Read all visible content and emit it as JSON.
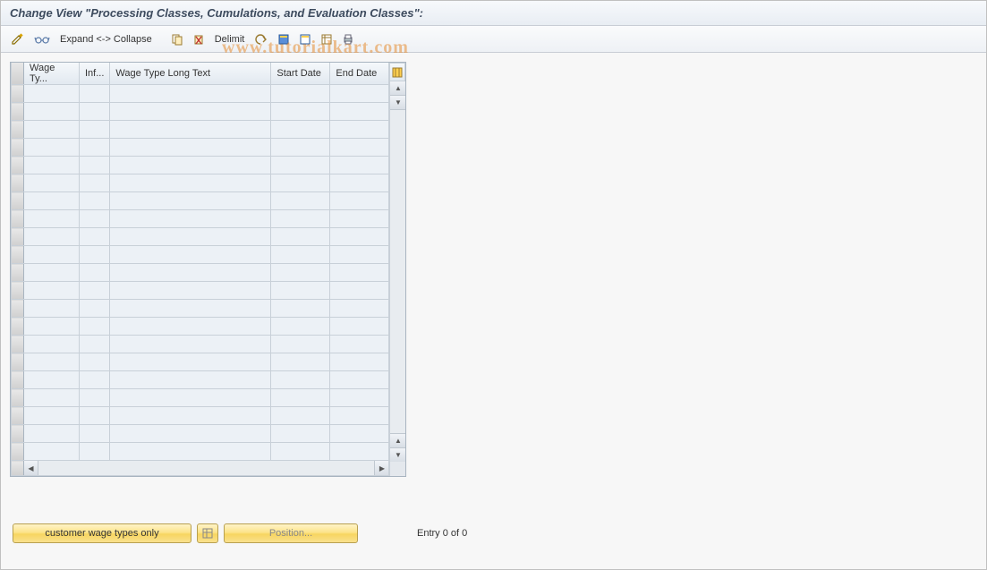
{
  "window": {
    "title": "Change View \"Processing Classes, Cumulations, and Evaluation Classes\":"
  },
  "toolbar": {
    "expand_label": "Expand <-> Collapse",
    "delimit_label": "Delimit"
  },
  "table": {
    "columns": {
      "wage_type": "Wage Ty...",
      "inf": "Inf...",
      "long_text": "Wage Type Long Text",
      "start_date": "Start Date",
      "end_date": "End Date"
    },
    "rows": [
      {},
      {},
      {},
      {},
      {},
      {},
      {},
      {},
      {},
      {},
      {},
      {},
      {},
      {},
      {},
      {},
      {},
      {},
      {},
      {},
      {}
    ]
  },
  "footer": {
    "customer_btn": "customer wage types only",
    "position_btn": "Position...",
    "entry_text": "Entry 0 of 0"
  },
  "watermark": "www.tutorialkart.com"
}
